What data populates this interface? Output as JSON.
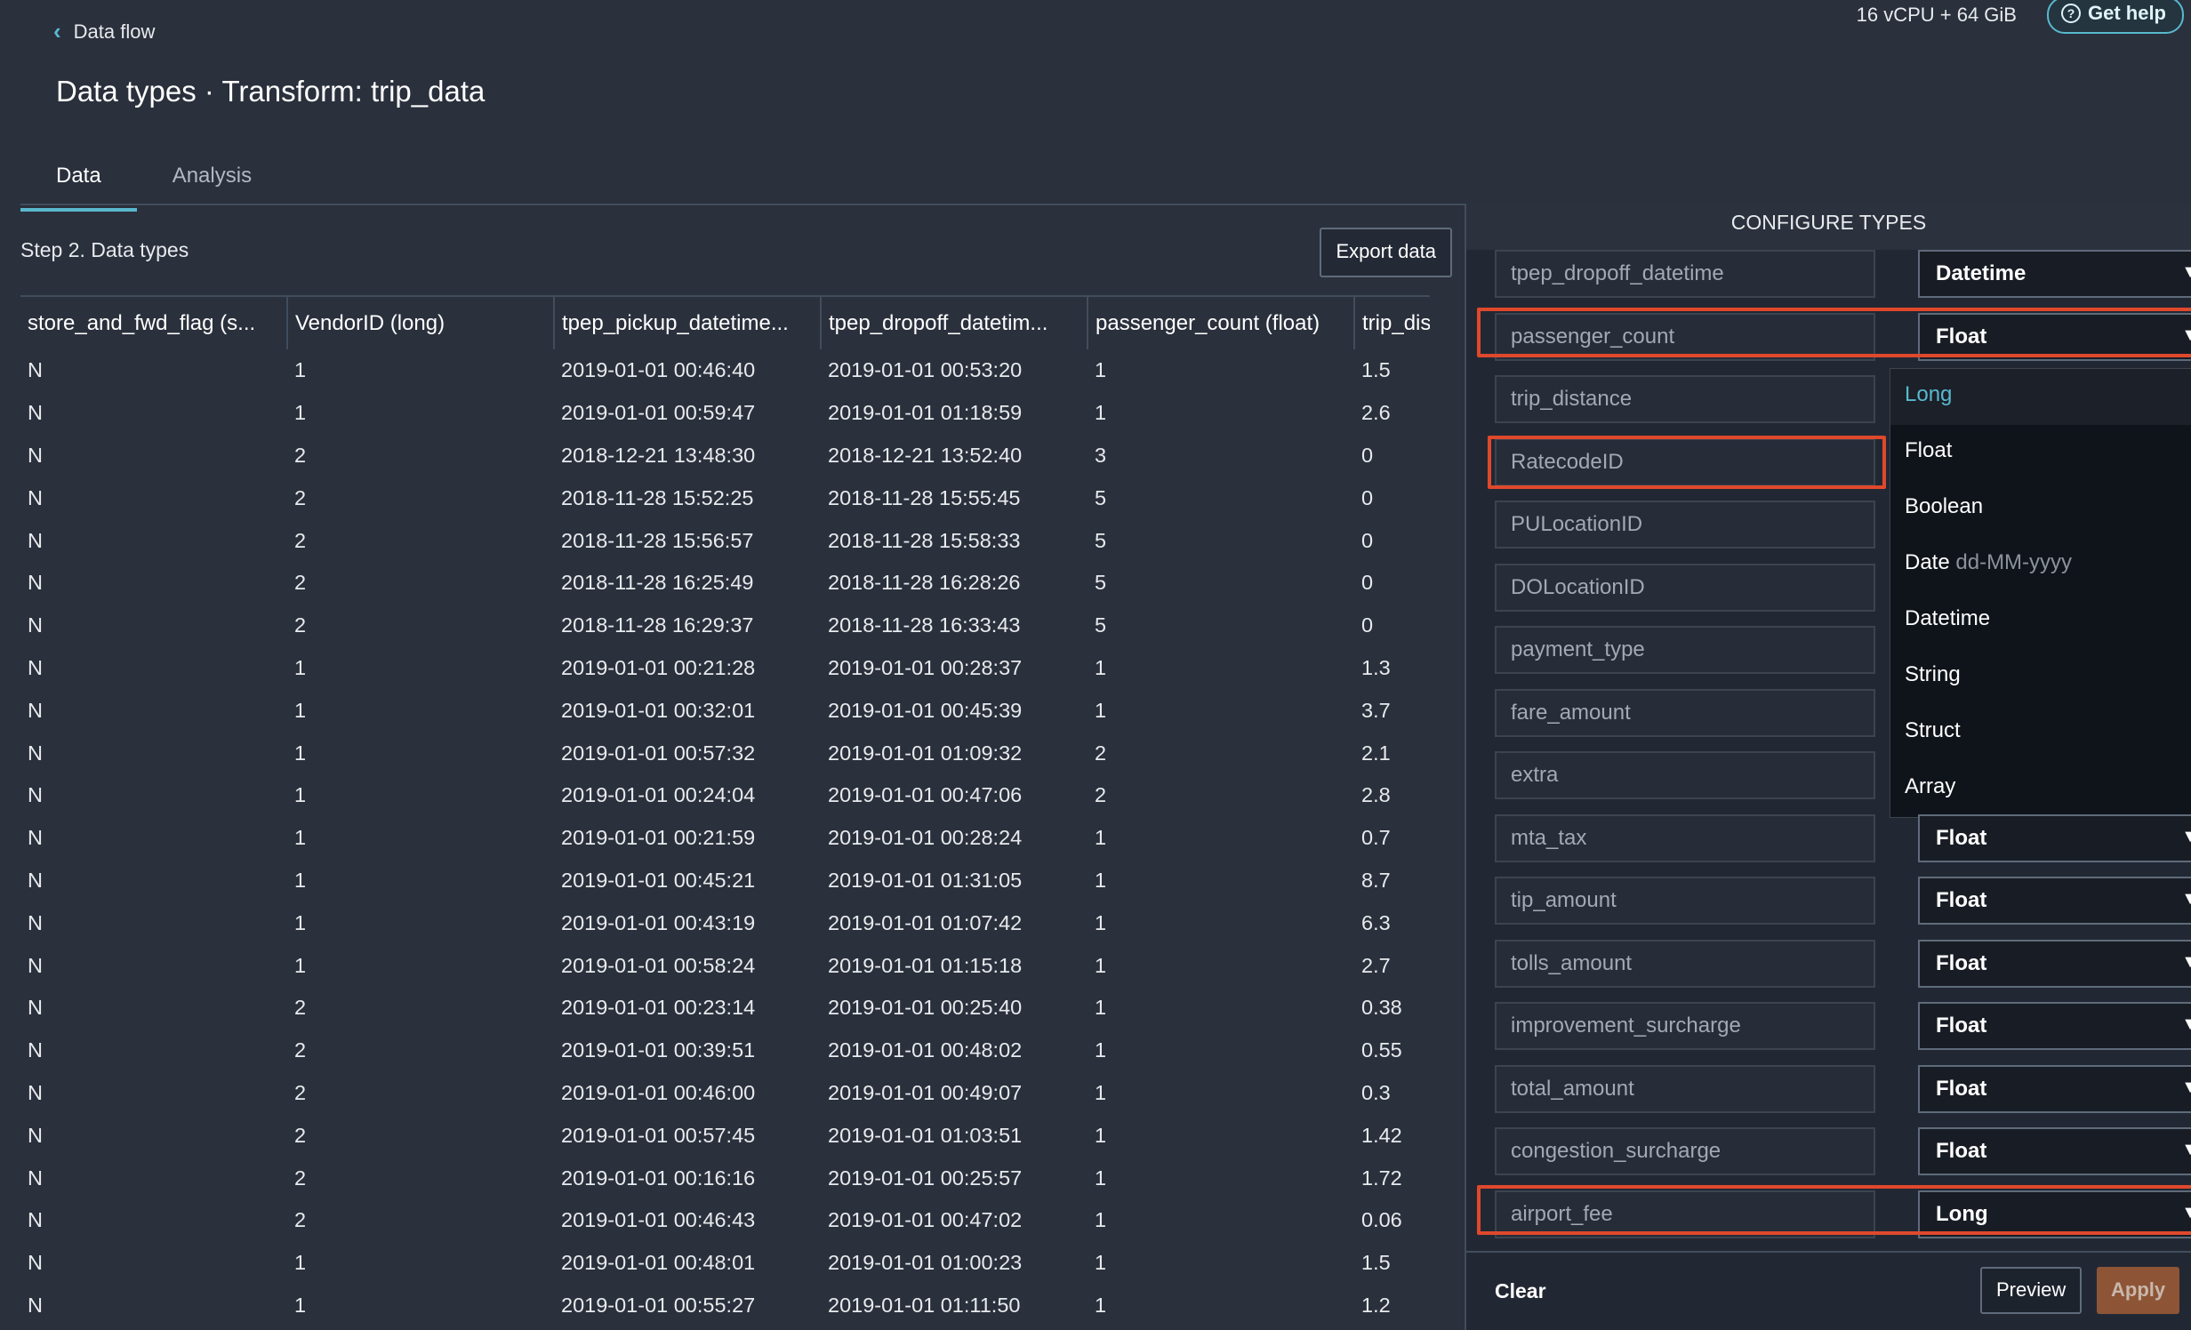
{
  "header": {
    "back_label": "Data flow",
    "title": "Data types · Transform: trip_data",
    "instance": "16 vCPU + 64 GiB",
    "help_label": "Get help"
  },
  "tabs": [
    {
      "label": "Data",
      "active": true
    },
    {
      "label": "Analysis",
      "active": false
    }
  ],
  "left": {
    "step_title": "Step 2. Data types",
    "export_label": "Export data",
    "columns": [
      "store_and_fwd_flag (s...",
      "VendorID (long)",
      "tpep_pickup_datetime...",
      "tpep_dropoff_datetim...",
      "passenger_count (float)",
      "trip_dis"
    ],
    "rows": [
      [
        "N",
        "1",
        "2019-01-01 00:46:40",
        "2019-01-01 00:53:20",
        "1",
        "1.5"
      ],
      [
        "N",
        "1",
        "2019-01-01 00:59:47",
        "2019-01-01 01:18:59",
        "1",
        "2.6"
      ],
      [
        "N",
        "2",
        "2018-12-21 13:48:30",
        "2018-12-21 13:52:40",
        "3",
        "0"
      ],
      [
        "N",
        "2",
        "2018-11-28 15:52:25",
        "2018-11-28 15:55:45",
        "5",
        "0"
      ],
      [
        "N",
        "2",
        "2018-11-28 15:56:57",
        "2018-11-28 15:58:33",
        "5",
        "0"
      ],
      [
        "N",
        "2",
        "2018-11-28 16:25:49",
        "2018-11-28 16:28:26",
        "5",
        "0"
      ],
      [
        "N",
        "2",
        "2018-11-28 16:29:37",
        "2018-11-28 16:33:43",
        "5",
        "0"
      ],
      [
        "N",
        "1",
        "2019-01-01 00:21:28",
        "2019-01-01 00:28:37",
        "1",
        "1.3"
      ],
      [
        "N",
        "1",
        "2019-01-01 00:32:01",
        "2019-01-01 00:45:39",
        "1",
        "3.7"
      ],
      [
        "N",
        "1",
        "2019-01-01 00:57:32",
        "2019-01-01 01:09:32",
        "2",
        "2.1"
      ],
      [
        "N",
        "1",
        "2019-01-01 00:24:04",
        "2019-01-01 00:47:06",
        "2",
        "2.8"
      ],
      [
        "N",
        "1",
        "2019-01-01 00:21:59",
        "2019-01-01 00:28:24",
        "1",
        "0.7"
      ],
      [
        "N",
        "1",
        "2019-01-01 00:45:21",
        "2019-01-01 01:31:05",
        "1",
        "8.7"
      ],
      [
        "N",
        "1",
        "2019-01-01 00:43:19",
        "2019-01-01 01:07:42",
        "1",
        "6.3"
      ],
      [
        "N",
        "1",
        "2019-01-01 00:58:24",
        "2019-01-01 01:15:18",
        "1",
        "2.7"
      ],
      [
        "N",
        "2",
        "2019-01-01 00:23:14",
        "2019-01-01 00:25:40",
        "1",
        "0.38"
      ],
      [
        "N",
        "2",
        "2019-01-01 00:39:51",
        "2019-01-01 00:48:02",
        "1",
        "0.55"
      ],
      [
        "N",
        "2",
        "2019-01-01 00:46:00",
        "2019-01-01 00:49:07",
        "1",
        "0.3"
      ],
      [
        "N",
        "2",
        "2019-01-01 00:57:45",
        "2019-01-01 01:03:51",
        "1",
        "1.42"
      ],
      [
        "N",
        "2",
        "2019-01-01 00:16:16",
        "2019-01-01 00:25:57",
        "1",
        "1.72"
      ],
      [
        "N",
        "2",
        "2019-01-01 00:46:43",
        "2019-01-01 00:47:02",
        "1",
        "0.06"
      ],
      [
        "N",
        "1",
        "2019-01-01 00:48:01",
        "2019-01-01 01:00:23",
        "1",
        "1.5"
      ],
      [
        "N",
        "1",
        "2019-01-01 00:55:27",
        "2019-01-01 01:11:50",
        "1",
        "1.2"
      ]
    ]
  },
  "configure": {
    "title": "CONFIGURE TYPES",
    "rows": [
      {
        "name": "tpep_dropoff_datetime",
        "type": "Datetime"
      },
      {
        "name": "passenger_count",
        "type": "Float",
        "highlight": true,
        "open": true
      },
      {
        "name": "trip_distance",
        "type": ""
      },
      {
        "name": "RatecodeID",
        "type": "",
        "highlight_name": true
      },
      {
        "name": "PULocationID",
        "type": ""
      },
      {
        "name": "DOLocationID",
        "type": ""
      },
      {
        "name": "payment_type",
        "type": ""
      },
      {
        "name": "fare_amount",
        "type": ""
      },
      {
        "name": "extra",
        "type": ""
      },
      {
        "name": "mta_tax",
        "type": "Float"
      },
      {
        "name": "tip_amount",
        "type": "Float"
      },
      {
        "name": "tolls_amount",
        "type": "Float"
      },
      {
        "name": "improvement_surcharge",
        "type": "Float"
      },
      {
        "name": "total_amount",
        "type": "Float"
      },
      {
        "name": "congestion_surcharge",
        "type": "Float"
      },
      {
        "name": "airport_fee",
        "type": "Long",
        "highlight": true
      }
    ],
    "options": [
      {
        "label": "Long",
        "hint": "",
        "selected": true
      },
      {
        "label": "Float",
        "hint": ""
      },
      {
        "label": "Boolean",
        "hint": ""
      },
      {
        "label": "Date",
        "hint": "dd-MM-yyyy"
      },
      {
        "label": "Datetime",
        "hint": ""
      },
      {
        "label": "String",
        "hint": ""
      },
      {
        "label": "Struct",
        "hint": ""
      },
      {
        "label": "Array",
        "hint": ""
      }
    ],
    "clear_label": "Clear",
    "preview_label": "Preview",
    "apply_label": "Apply"
  },
  "colors": {
    "accent": "#59b9ce",
    "highlight": "#e0482c",
    "apply": "#8d5536"
  }
}
